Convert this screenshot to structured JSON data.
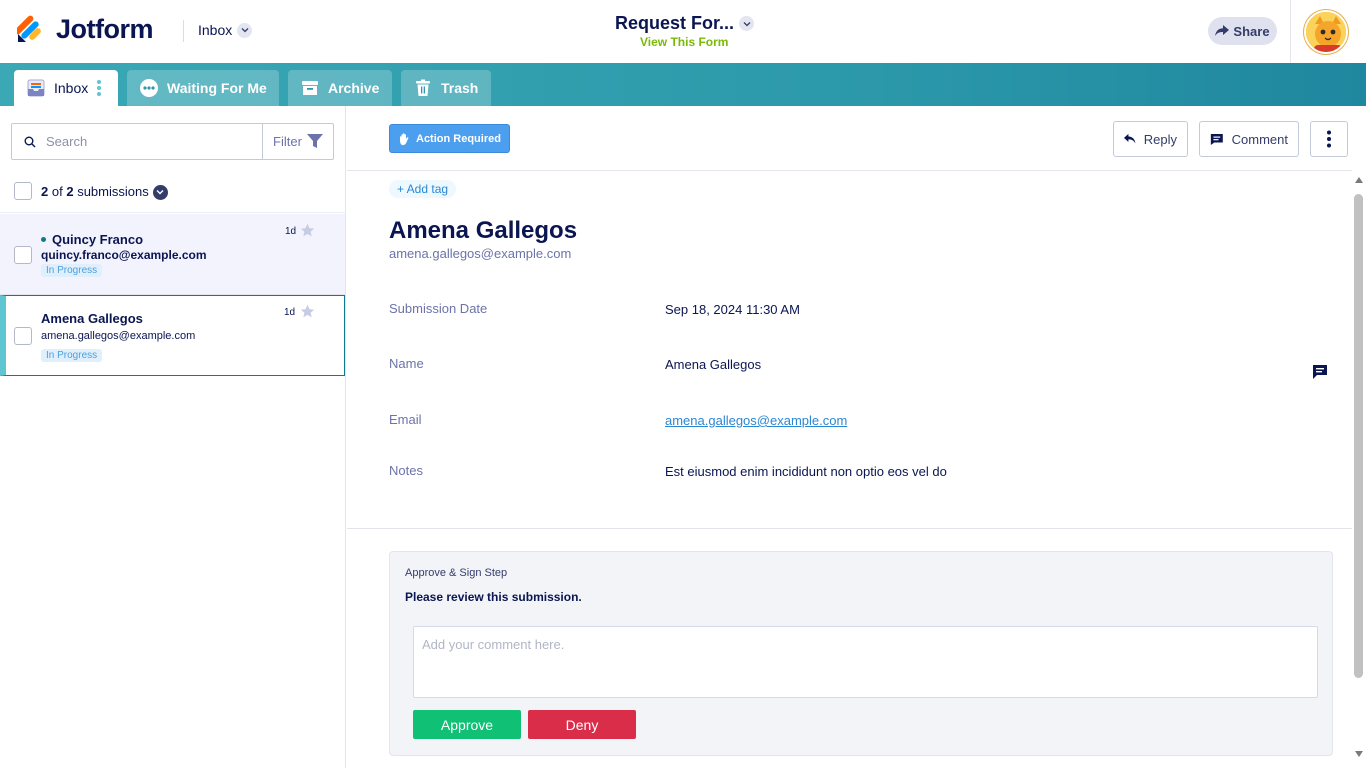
{
  "app": {
    "brand": "Jotform",
    "context_label": "Inbox",
    "form_title": "Request For...",
    "view_form_label": "View This Form",
    "share_label": "Share"
  },
  "tabs": [
    {
      "label": "Inbox",
      "active": true
    },
    {
      "label": "Waiting For Me",
      "active": false
    },
    {
      "label": "Archive",
      "active": false
    },
    {
      "label": "Trash",
      "active": false
    }
  ],
  "sidebar": {
    "search_placeholder": "Search",
    "filter_label": "Filter",
    "count": {
      "shown": "2",
      "of_label": "of",
      "total": "2",
      "suffix": "submissions"
    },
    "submissions": [
      {
        "name": "Quincy Franco",
        "email": "quincy.franco@example.com",
        "status": "In Progress",
        "age": "1d",
        "unread": true
      },
      {
        "name": "Amena Gallegos",
        "email": "amena.gallegos@example.com",
        "status": "In Progress",
        "age": "1d",
        "unread": false
      }
    ]
  },
  "toolbar": {
    "action_required_label": "Action Required",
    "reply_label": "Reply",
    "comment_label": "Comment"
  },
  "detail": {
    "add_tag_label": "+ Add tag",
    "name": "Amena Gallegos",
    "email": "amena.gallegos@example.com",
    "fields": [
      {
        "label": "Submission Date",
        "value": "Sep 18, 2024 11:30 AM"
      },
      {
        "label": "Name",
        "value": "Amena Gallegos"
      },
      {
        "label": "Email",
        "value": "amena.gallegos@example.com"
      },
      {
        "label": "Notes",
        "value": "Est eiusmod enim incididunt non optio eos vel do"
      }
    ]
  },
  "approval": {
    "step_title": "Approve & Sign Step",
    "message": "Please review this submission.",
    "comment_placeholder": "Add your comment here.",
    "approve_label": "Approve",
    "deny_label": "Deny"
  },
  "colors": {
    "brand_navy": "#0a1551",
    "tab_teal": "#2d9aab",
    "approve_green": "#0fc075",
    "deny_red": "#da2d4a",
    "action_blue": "#4c9fef",
    "view_form_green": "#78bb07"
  }
}
